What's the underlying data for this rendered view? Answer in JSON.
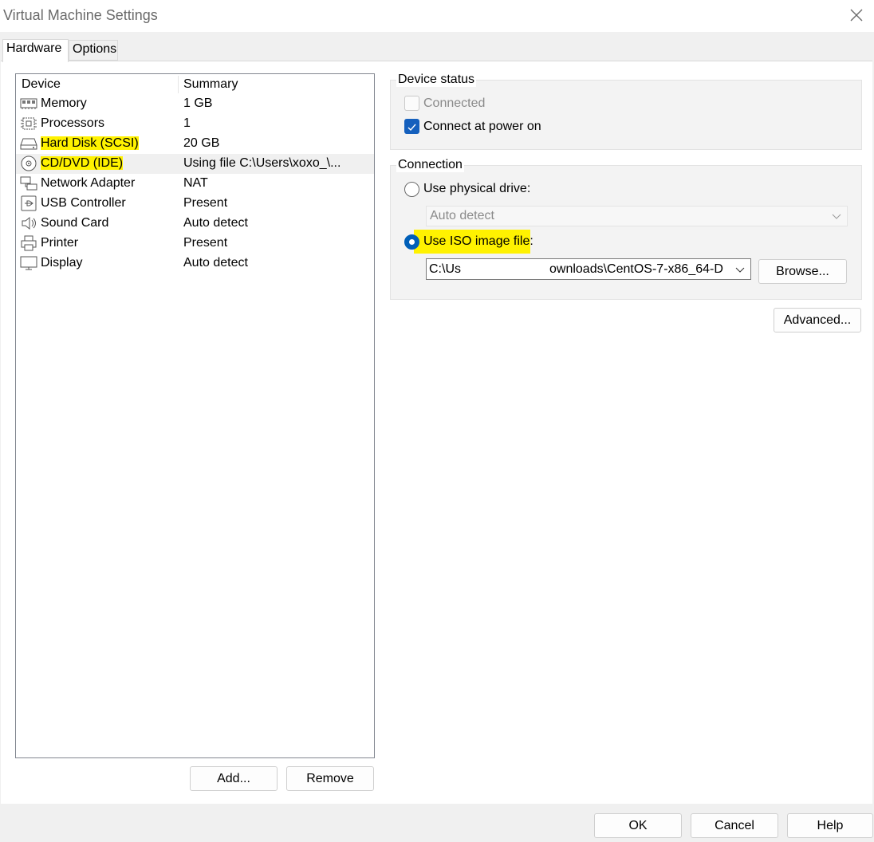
{
  "window": {
    "title": "Virtual Machine Settings"
  },
  "tabs": [
    {
      "label": "Hardware"
    },
    {
      "label": "Options"
    }
  ],
  "device_list": {
    "headers": {
      "device": "Device",
      "summary": "Summary"
    },
    "rows": [
      {
        "name": "Memory",
        "summary": "1 GB",
        "icon": "memory-icon"
      },
      {
        "name": "Processors",
        "summary": "1",
        "icon": "processor-icon"
      },
      {
        "name": "Hard Disk (SCSI)",
        "summary": "20 GB",
        "icon": "hard-disk-icon"
      },
      {
        "name": "CD/DVD (IDE)",
        "summary": "Using file C:\\Users\\xoxo_\\...",
        "icon": "cd-dvd-icon"
      },
      {
        "name": "Network Adapter",
        "summary": "NAT",
        "icon": "network-adapter-icon"
      },
      {
        "name": "USB Controller",
        "summary": "Present",
        "icon": "usb-icon"
      },
      {
        "name": "Sound Card",
        "summary": "Auto detect",
        "icon": "speaker-icon"
      },
      {
        "name": "Printer",
        "summary": "Present",
        "icon": "printer-icon"
      },
      {
        "name": "Display",
        "summary": "Auto detect",
        "icon": "monitor-icon"
      }
    ]
  },
  "list_buttons": {
    "add": "Add...",
    "remove": "Remove"
  },
  "device_status": {
    "title": "Device status",
    "connected": {
      "label": "Connected",
      "checked": false,
      "enabled": false
    },
    "connect_at_power_on": {
      "label": "Connect at power on",
      "checked": true
    }
  },
  "connection": {
    "title": "Connection",
    "physical": {
      "label": "Use physical drive:",
      "selected": false,
      "dropdown_value": "Auto detect"
    },
    "iso": {
      "label": "Use ISO image file:",
      "selected": true,
      "path_visible_start": "C:\\Us",
      "path_visible_end": "ownloads\\CentOS-7-x86_64-D",
      "browse_label": "Browse..."
    }
  },
  "advanced_label": "Advanced...",
  "footer": {
    "ok": "OK",
    "cancel": "Cancel",
    "help": "Help"
  },
  "colors": {
    "highlight": "#fff200",
    "accent": "#005fb8"
  }
}
